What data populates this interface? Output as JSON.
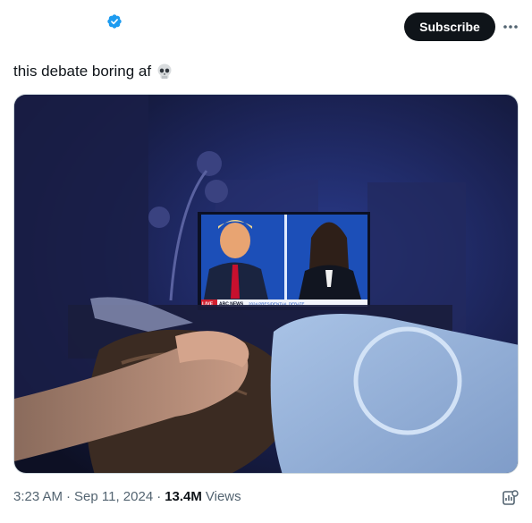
{
  "header": {
    "subscribe_label": "Subscribe"
  },
  "tweet": {
    "text": "this debate boring af"
  },
  "media": {
    "tv_banner_live": "LIVE",
    "tv_banner_network": "ABC NEWS",
    "tv_banner_text": "2024 PRESIDENTIAL DEBATE"
  },
  "meta": {
    "time": "3:23 AM",
    "separator": "·",
    "date": "Sep 11, 2024",
    "views_count": "13.4M",
    "views_label": "Views"
  },
  "colors": {
    "verified_blue": "#1d9bf0",
    "text_primary": "#0f1419",
    "text_secondary": "#536471",
    "subscribe_bg": "#0f1419"
  },
  "icons": {
    "verified": "verified-badge-icon",
    "more": "more-dots-icon",
    "skull": "skull-emoji-icon",
    "analytics": "analytics-icon"
  }
}
